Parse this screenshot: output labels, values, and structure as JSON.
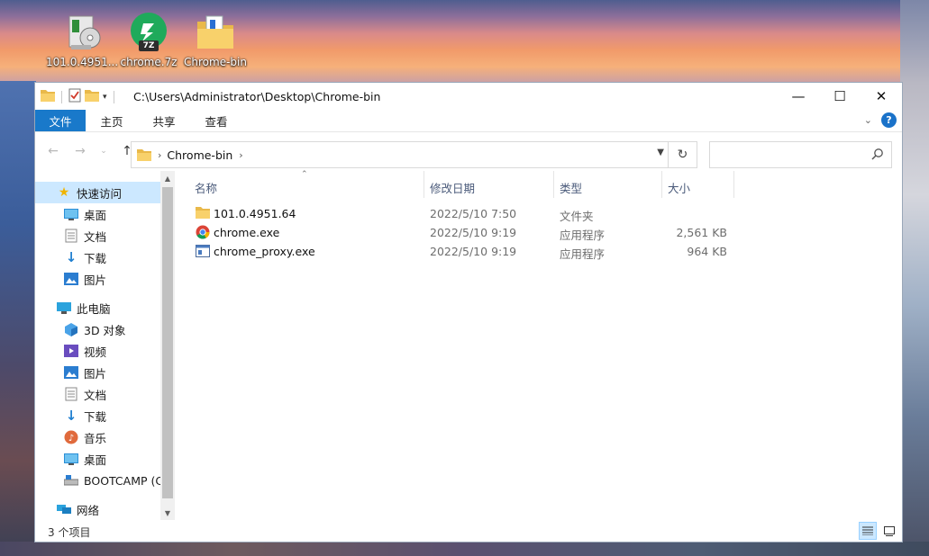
{
  "desktop": {
    "icons": [
      {
        "label": "101.0.4951..."
      },
      {
        "label": "chrome.7z",
        "badge": "7Z"
      },
      {
        "label": "Chrome-bin"
      }
    ]
  },
  "window": {
    "title_path": "C:\\Users\\Administrator\\Desktop\\Chrome-bin",
    "controls": {
      "minimize": "—",
      "maximize": "☐",
      "close": "✕"
    },
    "ribbon_tabs": [
      "文件",
      "主页",
      "共享",
      "查看"
    ],
    "help": "?",
    "address": {
      "crumb": "Chrome-bin"
    }
  },
  "sidebar": {
    "quick_access": "快速访问",
    "quick_items": [
      "桌面",
      "文档",
      "下载",
      "图片"
    ],
    "this_pc": "此电脑",
    "pc_items": [
      "3D 对象",
      "视频",
      "图片",
      "文档",
      "下载",
      "音乐",
      "桌面",
      "BOOTCAMP (C"
    ],
    "network": "网络"
  },
  "file_list": {
    "columns": {
      "name": "名称",
      "date": "修改日期",
      "type": "类型",
      "size": "大小"
    },
    "rows": [
      {
        "name": "101.0.4951.64",
        "date": "2022/5/10 7:50",
        "type": "文件夹",
        "size": "",
        "icon": "folder-icon"
      },
      {
        "name": "chrome.exe",
        "date": "2022/5/10 9:19",
        "type": "应用程序",
        "size": "2,561 KB",
        "icon": "chrome-icon"
      },
      {
        "name": "chrome_proxy.exe",
        "date": "2022/5/10 9:19",
        "type": "应用程序",
        "size": "964 KB",
        "icon": "app-icon"
      }
    ]
  },
  "status": {
    "count_text": "3 个项目"
  },
  "colors": {
    "accent": "#1979ca",
    "selection": "#cce8ff",
    "folder": "#f8d16b"
  }
}
